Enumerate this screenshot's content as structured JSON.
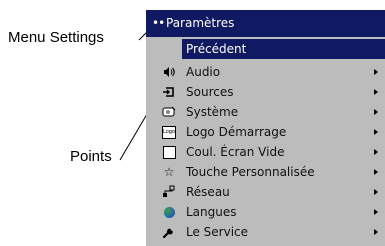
{
  "callouts": {
    "menu_settings": "Menu Settings",
    "points": "Points"
  },
  "menu": {
    "title": "Paramètres",
    "title_dots": "••",
    "colors": {
      "header_bg": "#0f1a63",
      "panel_bg": "#bcbcbc",
      "highlight": "#0f1a63"
    },
    "items": [
      {
        "label": "Précédent",
        "icon": "",
        "has_submenu": false,
        "selected": true
      },
      {
        "label": "Audio",
        "icon": "speaker-icon",
        "has_submenu": true
      },
      {
        "label": "Sources",
        "icon": "source-input-icon",
        "has_submenu": true
      },
      {
        "label": "Système",
        "icon": "system-icon",
        "has_submenu": true
      },
      {
        "label": "Logo Démarrage",
        "icon": "logo-icon",
        "icon_text": "Logo",
        "has_submenu": true
      },
      {
        "label": "Coul. Écran Vide",
        "icon": "blank-screen-icon",
        "has_submenu": true
      },
      {
        "label": "Touche Personnalisée",
        "icon": "star-icon",
        "has_submenu": true
      },
      {
        "label": "Réseau",
        "icon": "network-icon",
        "has_submenu": true
      },
      {
        "label": "Langues",
        "icon": "globe-icon",
        "has_submenu": true
      },
      {
        "label": "Le Service",
        "icon": "wrench-icon",
        "has_submenu": true
      }
    ]
  }
}
